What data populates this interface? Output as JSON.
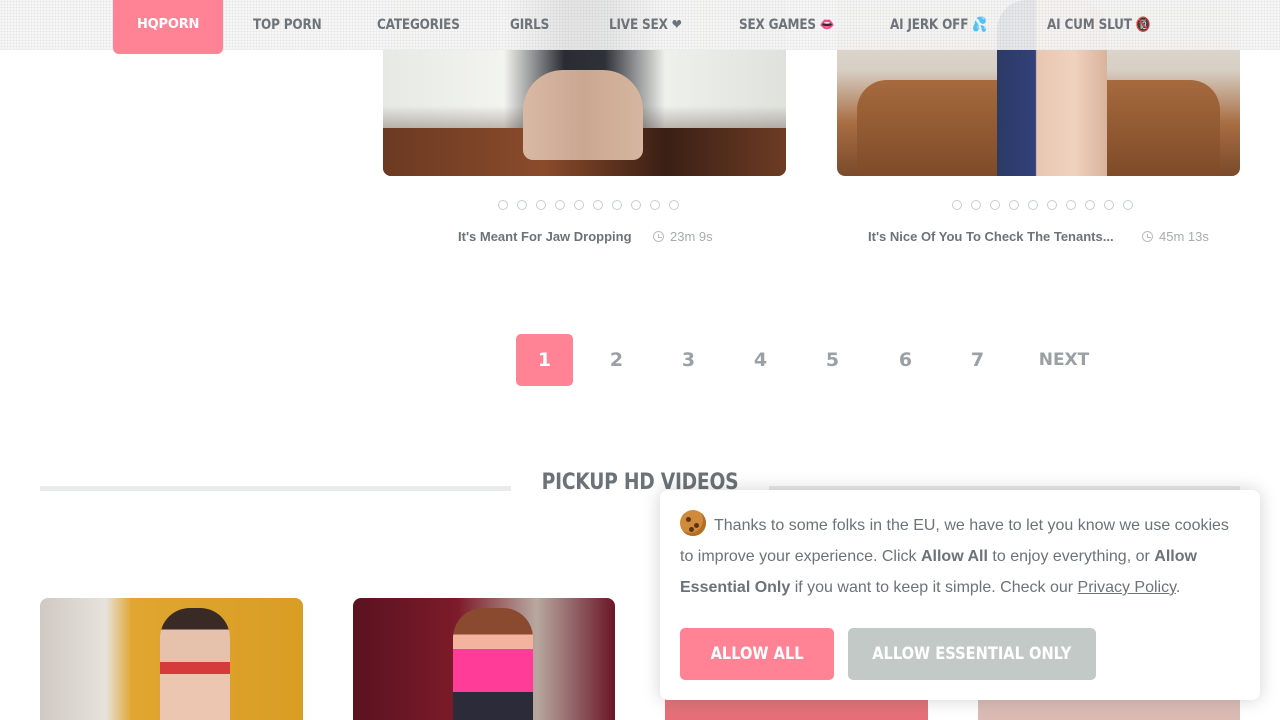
{
  "nav": {
    "items": [
      {
        "label": "HQPORN",
        "active": true
      },
      {
        "label": "TOP PORN"
      },
      {
        "label": "CATEGORIES"
      },
      {
        "label": "GIRLS"
      },
      {
        "label": "LIVE SEX ❤"
      },
      {
        "label": "SEX GAMES 👄"
      },
      {
        "label": "AI JERK OFF 💦"
      },
      {
        "label": "AI CUM SLUT 🔞"
      }
    ]
  },
  "videos": [
    {
      "title": "It's Meant For Jaw Dropping",
      "duration": "23m 9s"
    },
    {
      "title": "It's Nice Of You To Check The Tenants...",
      "duration": "45m 13s"
    }
  ],
  "pagination": {
    "pages": [
      "1",
      "2",
      "3",
      "4",
      "5",
      "6",
      "7"
    ],
    "current": "1",
    "next_label": "NEXT"
  },
  "section": {
    "title": "PICKUP HD VIDEOS"
  },
  "cookie": {
    "text_1": "Thanks to some folks in the EU, we have to let you know we use cookies to improve your experience. Click ",
    "bold_1": "Allow All",
    "text_2": " to enjoy everything, or ",
    "bold_2": "Allow Essential Only",
    "text_3": " if you want to keep it simple. Check our ",
    "privacy_link": "Privacy Policy",
    "text_4": ".",
    "allow_all": "ALLOW ALL",
    "allow_essential": "ALLOW ESSENTIAL ONLY"
  },
  "colors": {
    "accent": "#ff8395",
    "text": "#6b7378",
    "muted_button": "#c3c9c6"
  },
  "icons": [
    "clock-icon",
    "cookie-icon",
    "slide-dot-icon"
  ]
}
